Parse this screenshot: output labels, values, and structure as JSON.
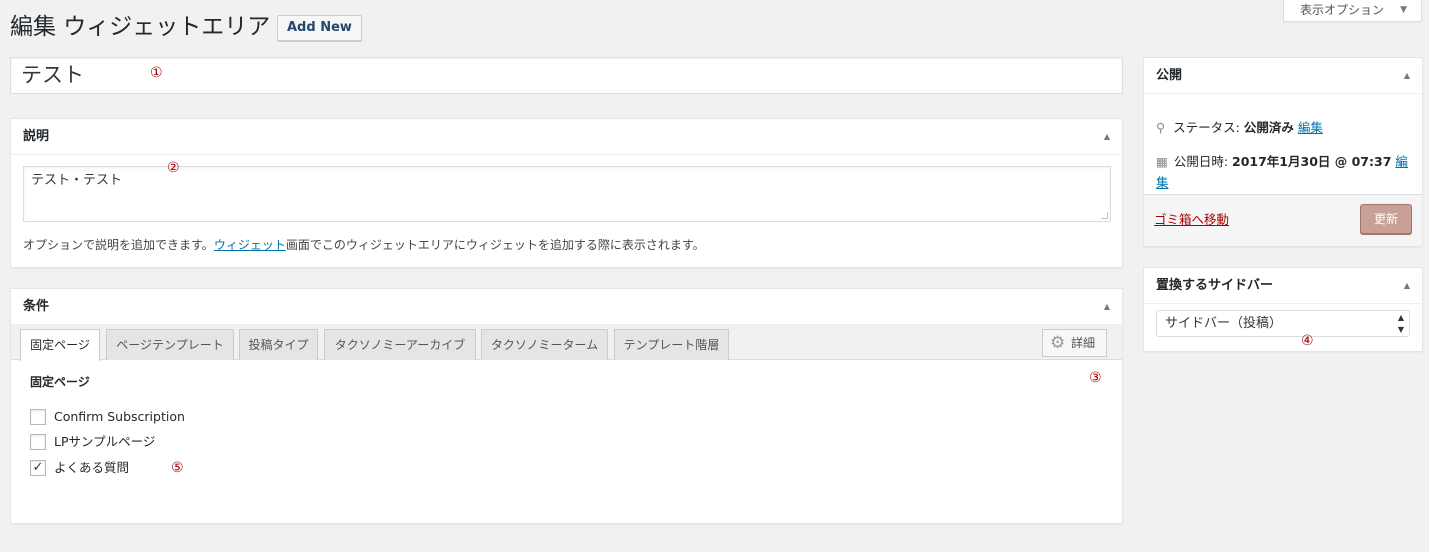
{
  "page": {
    "title": "編集 ウィジェットエリア",
    "add_new_label": "Add New",
    "screen_options_label": "表示オプション"
  },
  "title_field": {
    "value": "テスト"
  },
  "annotations": [
    "①",
    "②",
    "③",
    "④",
    "⑤"
  ],
  "description_box": {
    "heading": "説明",
    "textarea_value": "テスト・テスト",
    "hint_before": "オプションで説明を追加できます。",
    "hint_link": "ウィジェット",
    "hint_after": "画面でこのウィジェットエリアにウィジェットを追加する際に表示されます。"
  },
  "conditions_box": {
    "heading": "条件",
    "tabs": [
      {
        "label": "固定ページ",
        "active": true
      },
      {
        "label": "ページテンプレート",
        "active": false
      },
      {
        "label": "投稿タイプ",
        "active": false
      },
      {
        "label": "タクソノミーアーカイブ",
        "active": false
      },
      {
        "label": "タクソノミーターム",
        "active": false
      },
      {
        "label": "テンプレート階層",
        "active": false
      }
    ],
    "detail_label": "詳細",
    "section_label": "固定ページ",
    "pages": [
      {
        "label": "Confirm Subscription",
        "checked": false
      },
      {
        "label": "LPサンプルページ",
        "checked": false
      },
      {
        "label": "よくある質問",
        "checked": true
      }
    ]
  },
  "publish_box": {
    "heading": "公開",
    "status_label": "ステータス:",
    "status_value": "公開済み",
    "status_edit": "編集",
    "date_label": "公開日時:",
    "date_value": "2017年1月30日 @ 07:37",
    "date_edit_1": "編",
    "date_edit_2": "集",
    "trash_label": "ゴミ箱へ移動",
    "update_label": "更新"
  },
  "sidebar_box": {
    "heading": "置換するサイドバー",
    "selected": "サイドバー（投稿）"
  },
  "icons": {
    "toggle": "triangle-up-icon",
    "pin": "pin-icon",
    "calendar": "calendar-icon",
    "gear": "gear-icon",
    "checkmark": "checkmark-icon"
  },
  "colors": {
    "link": "#0073aa",
    "trash": "#aa0000",
    "annotation": "#aa0000",
    "update_button": "#c9a096"
  }
}
